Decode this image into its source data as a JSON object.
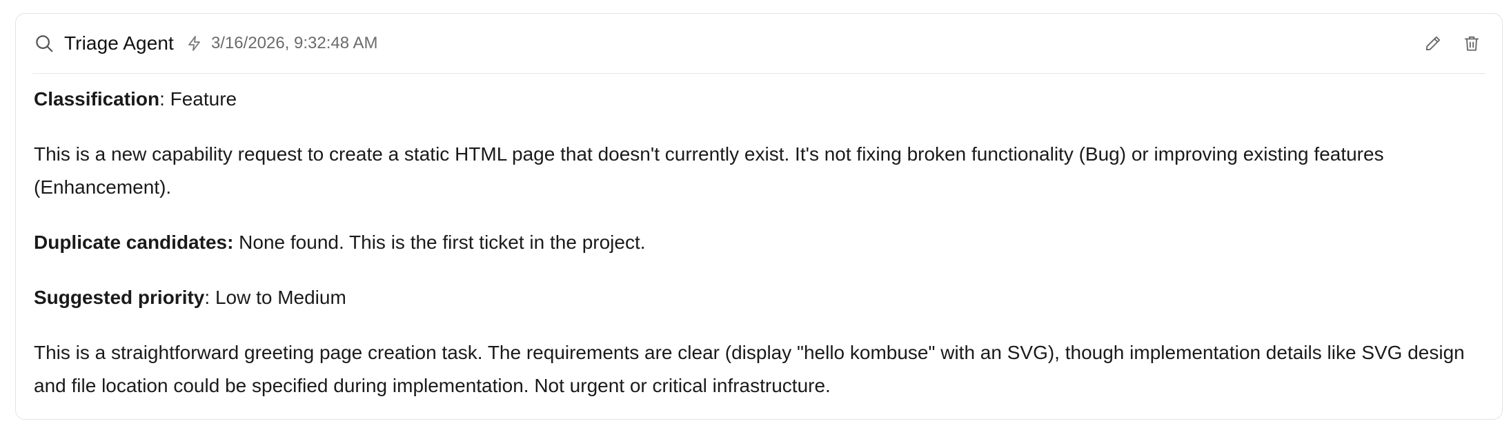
{
  "header": {
    "title": "Triage Agent",
    "timestamp": "3/16/2026, 9:32:48 AM",
    "icons": {
      "leading": "search-icon",
      "meta": "bolt-icon",
      "edit": "pencil-icon",
      "delete": "trash-icon"
    }
  },
  "content": {
    "classification": {
      "label": "Classification",
      "sep": ": ",
      "value": "Feature"
    },
    "paragraph1": "This is a new capability request to create a static HTML page that doesn't currently exist. It's not fixing broken functionality (Bug) or improving existing features (Enhancement).",
    "duplicates": {
      "label": "Duplicate candidates:",
      "value": " None found. This is the first ticket in the project."
    },
    "priority": {
      "label": "Suggested priority",
      "sep": ": ",
      "value": "Low to Medium"
    },
    "paragraph2": "This is a straightforward greeting page creation task. The requirements are clear (display \"hello kombuse\" with an SVG), though implementation details like SVG design and file location could be specified during implementation. Not urgent or critical infrastructure."
  },
  "colors": {
    "text": "#1a1a1a",
    "muted": "#6b6b6b",
    "border": "#e3e3e3",
    "icon": "#666666"
  }
}
